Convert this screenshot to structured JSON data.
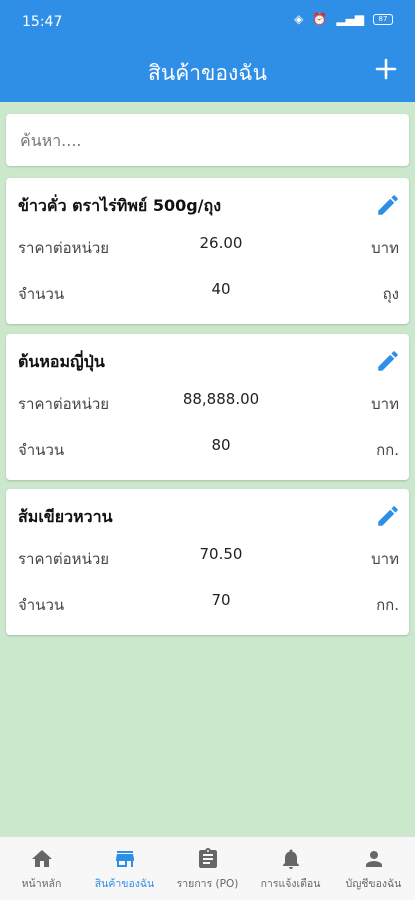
{
  "status_bar": {
    "time": "15:47",
    "battery": "87"
  },
  "header": {
    "title": "สินค้าของฉัน",
    "add_label": "+"
  },
  "search": {
    "placeholder": "ค้นหา...."
  },
  "products": [
    {
      "name": "ข้าวคั่ว ตราไร่ทิพย์ 500g/ถุง",
      "price_label": "ราคาต่อหน่วย",
      "price": "26.00",
      "price_unit": "บาท",
      "qty_label": "จำนวน",
      "qty": "40",
      "qty_unit": "ถุง"
    },
    {
      "name": "ต้นหอมญี่ปุ่น",
      "price_label": "ราคาต่อหน่วย",
      "price": "88,888.00",
      "price_unit": "บาท",
      "qty_label": "จำนวน",
      "qty": "80",
      "qty_unit": "กก."
    },
    {
      "name": "ส้มเขียวหวาน",
      "price_label": "ราคาต่อหน่วย",
      "price": "70.50",
      "price_unit": "บาท",
      "qty_label": "จำนวน",
      "qty": "70",
      "qty_unit": "กก."
    }
  ],
  "bottom_nav": [
    {
      "label": "หน้าหลัก",
      "icon": "home-icon"
    },
    {
      "label": "สินค้าของฉัน",
      "icon": "store-icon"
    },
    {
      "label": "รายการ (PO)",
      "icon": "clipboard-icon"
    },
    {
      "label": "การแจ้งเตือน",
      "icon": "bell-icon"
    },
    {
      "label": "บัญชีของฉัน",
      "icon": "person-icon"
    }
  ],
  "colors": {
    "primary": "#2f8fe6",
    "background": "#cbe8cc"
  }
}
